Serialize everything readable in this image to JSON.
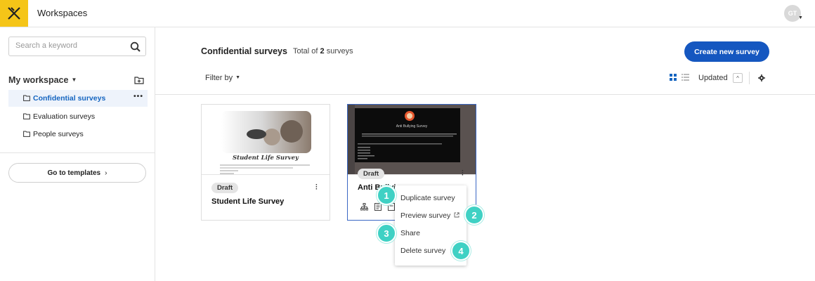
{
  "topbar": {
    "title": "Workspaces",
    "avatar_initials": "GT"
  },
  "sidebar": {
    "search_placeholder": "Search a keyword",
    "workspace_label": "My workspace",
    "folders": [
      {
        "label": "Confidential surveys",
        "active": true
      },
      {
        "label": "Evaluation surveys",
        "active": false
      },
      {
        "label": "People surveys",
        "active": false
      }
    ],
    "templates_button": "Go to templates"
  },
  "main": {
    "title": "Confidential surveys",
    "total_prefix": "Total of",
    "total_count": "2",
    "total_suffix": "surveys",
    "create_button": "Create new survey",
    "filter_label": "Filter by",
    "sort_label": "Updated"
  },
  "cards": [
    {
      "status": "Draft",
      "title": "Student Life Survey",
      "thumb_heading": "Student Life Survey"
    },
    {
      "status": "Draft",
      "title": "Anti Bullying Survey",
      "thumb_heading": "Anti Bullying Survey"
    }
  ],
  "context_menu": {
    "items": [
      {
        "label": "Duplicate survey",
        "step": "1"
      },
      {
        "label": "Preview survey",
        "step": "2"
      },
      {
        "label": "Share",
        "step": "3"
      },
      {
        "label": "Delete survey",
        "step": "4"
      }
    ]
  },
  "colors": {
    "brand_yellow": "#f5c518",
    "primary_blue": "#1557c0",
    "step_badge": "#3fd1c4"
  }
}
